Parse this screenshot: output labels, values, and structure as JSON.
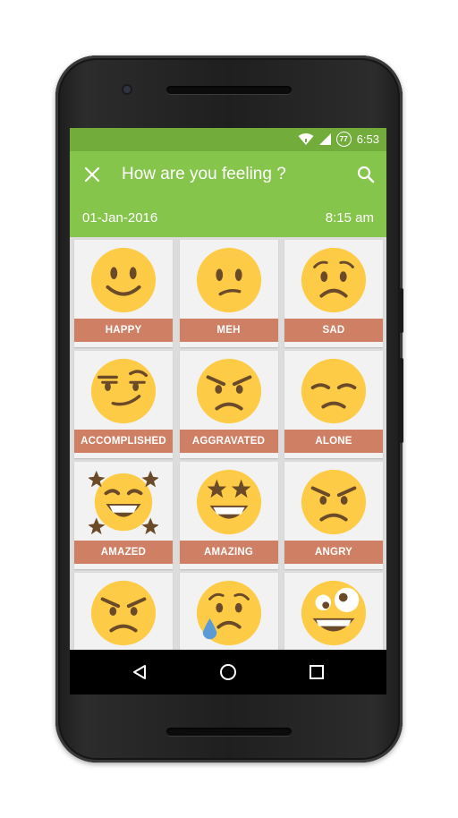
{
  "status_bar": {
    "time": "6:53",
    "battery_level": "77"
  },
  "app_bar": {
    "title": "How are you feeling ?",
    "date": "01-Jan-2016",
    "time": "8:15 am"
  },
  "moods": [
    {
      "label": "HAPPY",
      "icon": "smiling-face-icon"
    },
    {
      "label": "MEH",
      "icon": "confused-face-icon"
    },
    {
      "label": "SAD",
      "icon": "sad-face-icon"
    },
    {
      "label": "ACCOMPLISHED",
      "icon": "smirking-face-icon"
    },
    {
      "label": "AGGRAVATED",
      "icon": "angry-face-icon"
    },
    {
      "label": "ALONE",
      "icon": "disappointed-face-icon"
    },
    {
      "label": "AMAZED",
      "icon": "star-struck-laughing-face-icon"
    },
    {
      "label": "AMAZING",
      "icon": "star-eyes-face-icon"
    },
    {
      "label": "ANGRY",
      "icon": "angry-face-icon"
    },
    {
      "label": "",
      "icon": "angry-face-icon"
    },
    {
      "label": "",
      "icon": "sad-sweat-face-icon"
    },
    {
      "label": "",
      "icon": "zany-face-icon"
    }
  ],
  "colors": {
    "status_bar": "#72ad3c",
    "app_bar": "#86c54b",
    "label_bar": "#cf7f63",
    "face": "#fdcb45",
    "feature": "#6b4a2a"
  }
}
